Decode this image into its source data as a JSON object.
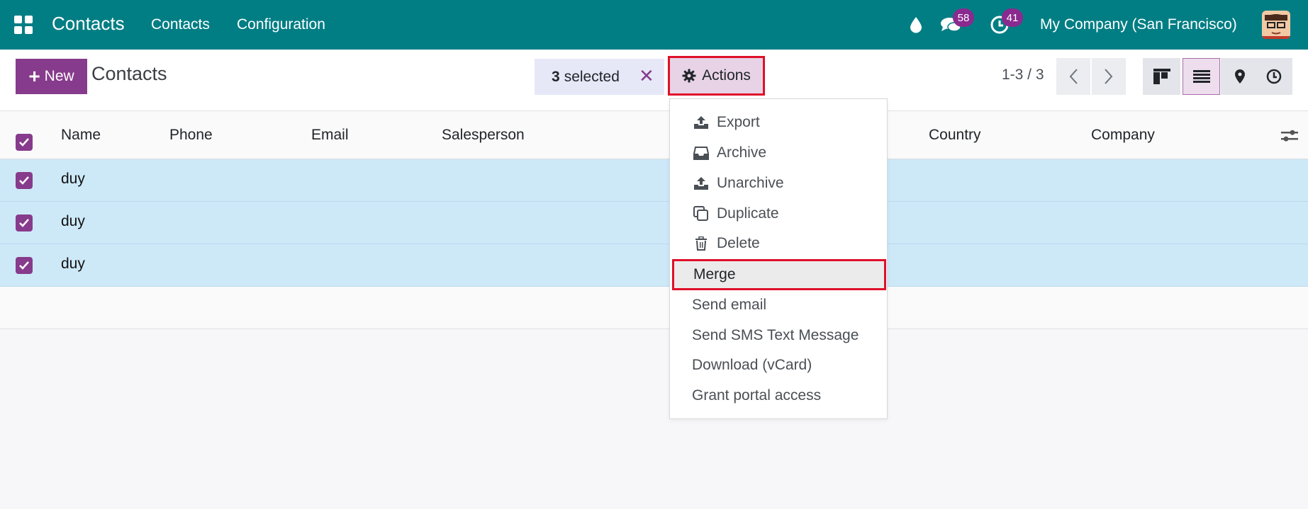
{
  "navbar": {
    "app_name": "Contacts",
    "menus": [
      "Contacts",
      "Configuration"
    ],
    "chat_badge": "58",
    "activity_badge": "41",
    "company": "My Company (San Francisco)",
    "color": "#017e84"
  },
  "control_panel": {
    "new_label": "New",
    "title": "Contacts",
    "selected_count": "3",
    "selected_label": "selected",
    "actions_label": "Actions",
    "pager": "1-3 / 3"
  },
  "table": {
    "columns": [
      "Name",
      "Phone",
      "Email",
      "Salesperson",
      "Country",
      "Company"
    ],
    "rows": [
      {
        "name": "duy"
      },
      {
        "name": "duy"
      },
      {
        "name": "duy"
      }
    ]
  },
  "actions_menu": {
    "items": [
      {
        "label": "Export",
        "icon": "upload-icon"
      },
      {
        "label": "Archive",
        "icon": "inbox-icon"
      },
      {
        "label": "Unarchive",
        "icon": "upload-icon"
      },
      {
        "label": "Duplicate",
        "icon": "copy-icon"
      },
      {
        "label": "Delete",
        "icon": "trash-icon"
      },
      {
        "label": "Merge"
      },
      {
        "label": "Send email"
      },
      {
        "label": "Send SMS Text Message"
      },
      {
        "label": "Download (vCard)"
      },
      {
        "label": "Grant portal access"
      }
    ]
  },
  "colors": {
    "accent": "#873b8c",
    "selected_row": "#cde9f8",
    "highlight_border": "#e0102a"
  }
}
